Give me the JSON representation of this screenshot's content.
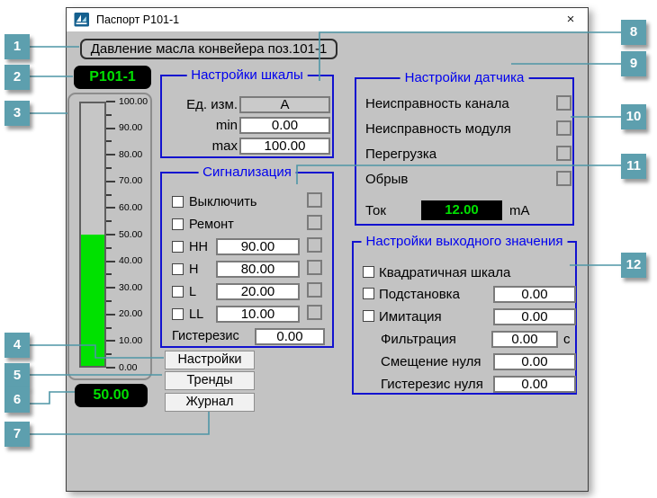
{
  "window": {
    "title": "Паспорт Р101-1",
    "close_glyph": "×"
  },
  "header": {
    "description": "Давление масла конвейера поз.101-1",
    "tag": "P101-1"
  },
  "gauge": {
    "min": 0,
    "max": 100,
    "value": 50,
    "tick_labels": [
      "100.00",
      "90.00",
      "80.00",
      "70.00",
      "60.00",
      "50.00",
      "40.00",
      "30.00",
      "20.00",
      "10.00",
      "0.00"
    ],
    "value_display": "50.00"
  },
  "scale_group": {
    "title": "Настройки шкалы",
    "unit_label": "Ед. изм.",
    "unit_value": "А",
    "min_label": "min",
    "min_value": "0.00",
    "max_label": "max",
    "max_value": "100.00"
  },
  "alarm_group": {
    "title": "Сигнализация",
    "toggle_rows": [
      {
        "label": "Выключить"
      },
      {
        "label": "Ремонт"
      }
    ],
    "limit_rows": [
      {
        "label": "HH",
        "value": "90.00"
      },
      {
        "label": "H",
        "value": "80.00"
      },
      {
        "label": "L",
        "value": "20.00"
      },
      {
        "label": "LL",
        "value": "10.00"
      }
    ],
    "hysteresis_label": "Гистерезис",
    "hysteresis_value": "0.00"
  },
  "sensor_group": {
    "title": "Настройки датчика",
    "status_rows": [
      {
        "label": "Неисправность канала"
      },
      {
        "label": "Неисправность модуля"
      },
      {
        "label": "Перегрузка"
      },
      {
        "label": "Обрыв"
      }
    ],
    "current_label": "Ток",
    "current_value": "12.00",
    "current_unit": "mA"
  },
  "output_group": {
    "title": "Настройки выходного значения",
    "checkbox_rows": [
      {
        "label": "Квадратичная шкала",
        "value": ""
      },
      {
        "label": "Подстановка",
        "value": "0.00"
      },
      {
        "label": "Имитация",
        "value": "0.00"
      }
    ],
    "field_rows": [
      {
        "label": "Фильтрация",
        "value": "0.00",
        "unit": "с"
      },
      {
        "label": "Смещение нуля",
        "value": "0.00",
        "unit": ""
      },
      {
        "label": "Гистерезис нуля",
        "value": "0.00",
        "unit": ""
      }
    ]
  },
  "buttons": [
    {
      "label": "Настройки"
    },
    {
      "label": "Тренды"
    },
    {
      "label": "Журнал"
    }
  ],
  "callouts": {
    "numbers": [
      "1",
      "2",
      "3",
      "4",
      "5",
      "6",
      "7",
      "8",
      "9",
      "10",
      "11",
      "12"
    ]
  },
  "colors": {
    "group_border": "#1212cf",
    "group_title": "#0000ee",
    "badge": "#5d9fae",
    "callout_line": "#4e96a6",
    "display_green": "#00e100",
    "display_bg": "#000000",
    "window_bg": "#c3c3c3"
  }
}
